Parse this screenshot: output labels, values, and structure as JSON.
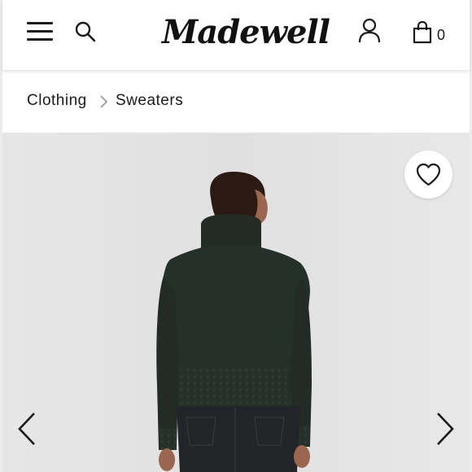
{
  "header": {
    "brand": "Madewell",
    "bag_count": "0",
    "icons": {
      "menu": "hamburger-menu-icon",
      "search": "search-icon",
      "account": "account-icon",
      "bag": "shopping-bag-icon"
    }
  },
  "breadcrumb": {
    "items": [
      {
        "label": "Clothing"
      },
      {
        "label": "Sweaters"
      }
    ],
    "separator_icon": "chevron-right-icon"
  },
  "gallery": {
    "image_alt_icon": "product-photo",
    "favorite_icon": "heart-icon",
    "prev_icon": "chevron-left-icon",
    "next_icon": "chevron-right-icon"
  },
  "colors": {
    "header_bg": "#ffffff",
    "photo_bg": "#e3e3e3",
    "sweater": "#26302a",
    "text": "#1a1a1a"
  }
}
